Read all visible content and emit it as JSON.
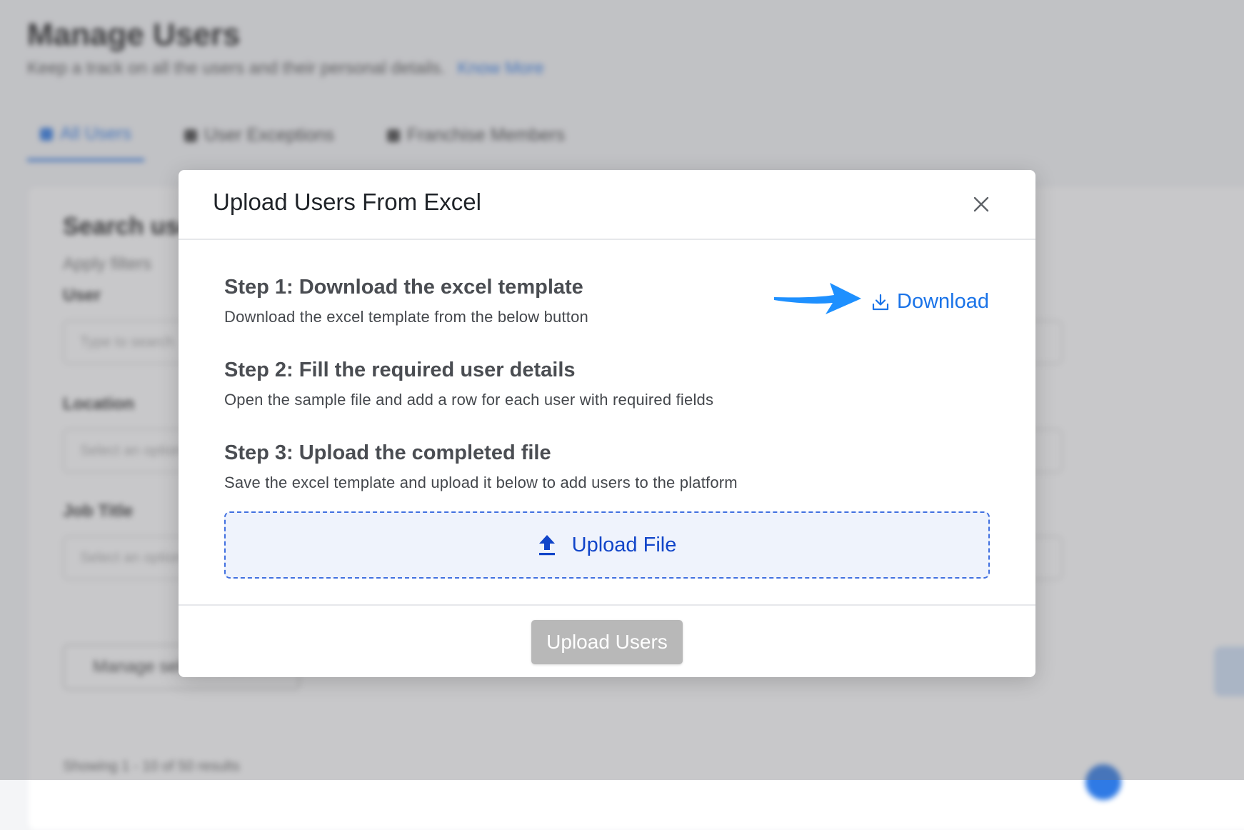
{
  "background": {
    "title": "Manage Users",
    "subtitle": "Keep a track on all the users and their personal details.",
    "subtitle_link": "Know More",
    "tabs": [
      "All Users",
      "User Exceptions",
      "Franchise Members"
    ],
    "card_title": "Search users",
    "card_subtitle": "Apply filters",
    "labels": [
      "User",
      "Location",
      "Job Title"
    ],
    "inputs": [
      "Type to search",
      "Select an option",
      "Select an option"
    ],
    "button": "Manage selected users",
    "footer": "Showing 1 - 10 of 50 results"
  },
  "modal": {
    "title": "Upload Users From Excel",
    "close_icon": "close-icon",
    "steps": [
      {
        "title": "Step 1: Download the excel template",
        "description": "Download the excel template from the below button"
      },
      {
        "title": "Step 2: Fill the required user details",
        "description": "Open the sample file and add a row for each user with required fields"
      },
      {
        "title": "Step 3: Upload the completed file",
        "description": "Save the excel template and upload it below to add users to the platform"
      }
    ],
    "download_label": "Download",
    "download_icon": "download-icon",
    "upload_zone_label": "Upload File",
    "upload_icon": "upload-icon",
    "submit_label": "Upload Users",
    "submit_disabled": true
  },
  "colors": {
    "accent": "#1a73e8",
    "upload_zone_text": "#1145c9",
    "arrow": "#1e90ff",
    "disabled_button": "#b8b8b8"
  }
}
